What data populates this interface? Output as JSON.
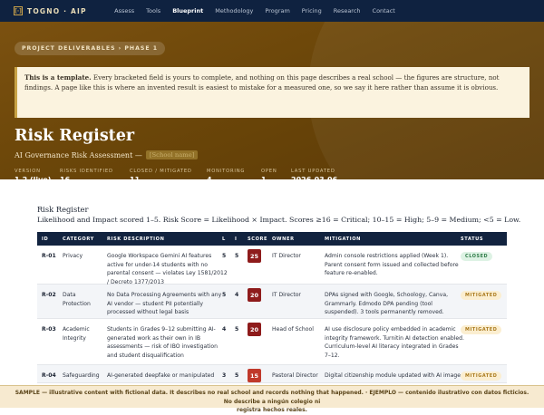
{
  "nav": {
    "brand_mark": "[·]",
    "brand": "TOGNO · AIP",
    "links": [
      "Assess",
      "Tools",
      "Blueprint",
      "Methodology",
      "Program",
      "Pricing",
      "Research",
      "Contact"
    ],
    "active_index": 2
  },
  "hero": {
    "crumb": "PROJECT DELIVERABLES › PHASE 1",
    "notice_bold": "This is a template.",
    "notice_text": " Every bracketed field is yours to complete, and nothing on this page describes a real school — the figures are structure, not findings. A page like this is where an invented result is easiest to mistake for a measured one, so we say it here rather than assume it is obvious.",
    "title": "Risk Register",
    "subtitle": "AI Governance Risk Assessment —",
    "subtitle_redacted": "[School name]",
    "metrics": [
      {
        "label": "VERSION",
        "value": "1.2 (live)"
      },
      {
        "label": "RISKS IDENTIFIED",
        "value": "16"
      },
      {
        "label": "CLOSED / MITIGATED",
        "value": "11"
      },
      {
        "label": "MONITORING",
        "value": "4"
      },
      {
        "label": "OPEN",
        "value": "1"
      },
      {
        "label": "LAST UPDATED",
        "value": "2026-03-06"
      }
    ]
  },
  "section": {
    "title": "Risk Register",
    "description": "Likelihood and Impact scored 1–5. Risk Score = Likelihood × Impact. Scores ≥16 = Critical; 10–15 = High; 5–9 = Medium; <5 = Low."
  },
  "table": {
    "headers": [
      "ID",
      "CATEGORY",
      "RISK DESCRIPTION",
      "L",
      "I",
      "SCORE",
      "OWNER",
      "MITIGATION",
      "STATUS"
    ],
    "rows": [
      {
        "id": "R-01",
        "category": [
          "Privacy"
        ],
        "description": [
          "Google Workspace Gemini AI features",
          "active for under-14 students with no",
          "parental consent — violates Ley 1581/2012",
          "/ Decreto 1377/2013"
        ],
        "l": "5",
        "i": "5",
        "score": "25",
        "score_color": "#8e1b1b",
        "owner": "IT Director",
        "mitigation": [
          "Admin console restrictions applied (Week 1).",
          "Parent consent form issued and collected before",
          "feature re-enabled."
        ],
        "status": "CLOSED",
        "status_kind": "closed"
      },
      {
        "id": "R-02",
        "category": [
          "Data",
          "Protection"
        ],
        "description": [
          "No Data Processing Agreements with any",
          "AI vendor — student PII potentially",
          "processed without legal basis"
        ],
        "l": "5",
        "i": "4",
        "score": "20",
        "score_color": "#8e1b1b",
        "owner": "IT Director",
        "mitigation": [
          "DPAs signed with Google, Schoology, Canva,",
          "Grammarly. Edmodo DPA pending (tool",
          "suspended). 3 tools permanently removed."
        ],
        "status": "MITIGATED",
        "status_kind": "mitigated"
      },
      {
        "id": "R-03",
        "category": [
          "Academic",
          "Integrity"
        ],
        "description": [
          "Students in Grades 9–12 submitting AI-",
          "generated work as their own in IB",
          "assessments — risk of IBO investigation",
          "and student disqualification"
        ],
        "l": "4",
        "i": "5",
        "score": "20",
        "score_color": "#8e1b1b",
        "owner": "Head of School",
        "mitigation": [
          "AI use disclosure policy embedded in academic",
          "integrity framework. Turnitin AI detection enabled.",
          "Curriculum-level AI literacy integrated in Grades",
          "7–12."
        ],
        "status": "MITIGATED",
        "status_kind": "mitigated"
      },
      {
        "id": "R-04",
        "category": [
          "Safeguarding"
        ],
        "description": [
          "AI-generated deepfake or manipulated"
        ],
        "l": "3",
        "i": "5",
        "score": "15",
        "score_color": "#c0392b",
        "owner": "Pastoral Director",
        "mitigation": [
          "Digital citizenship module updated with AI image"
        ],
        "status": "MITIGATED",
        "status_kind": "mitigated"
      }
    ]
  },
  "banner": {
    "line1": "SAMPLE — illustrative content with fictional data. It describes no real school and records nothing that happened. · EJEMPLO — contenido ilustrativo con datos ficticios. No describe a ningún colegio ni",
    "line2": "registra hechos reales."
  }
}
